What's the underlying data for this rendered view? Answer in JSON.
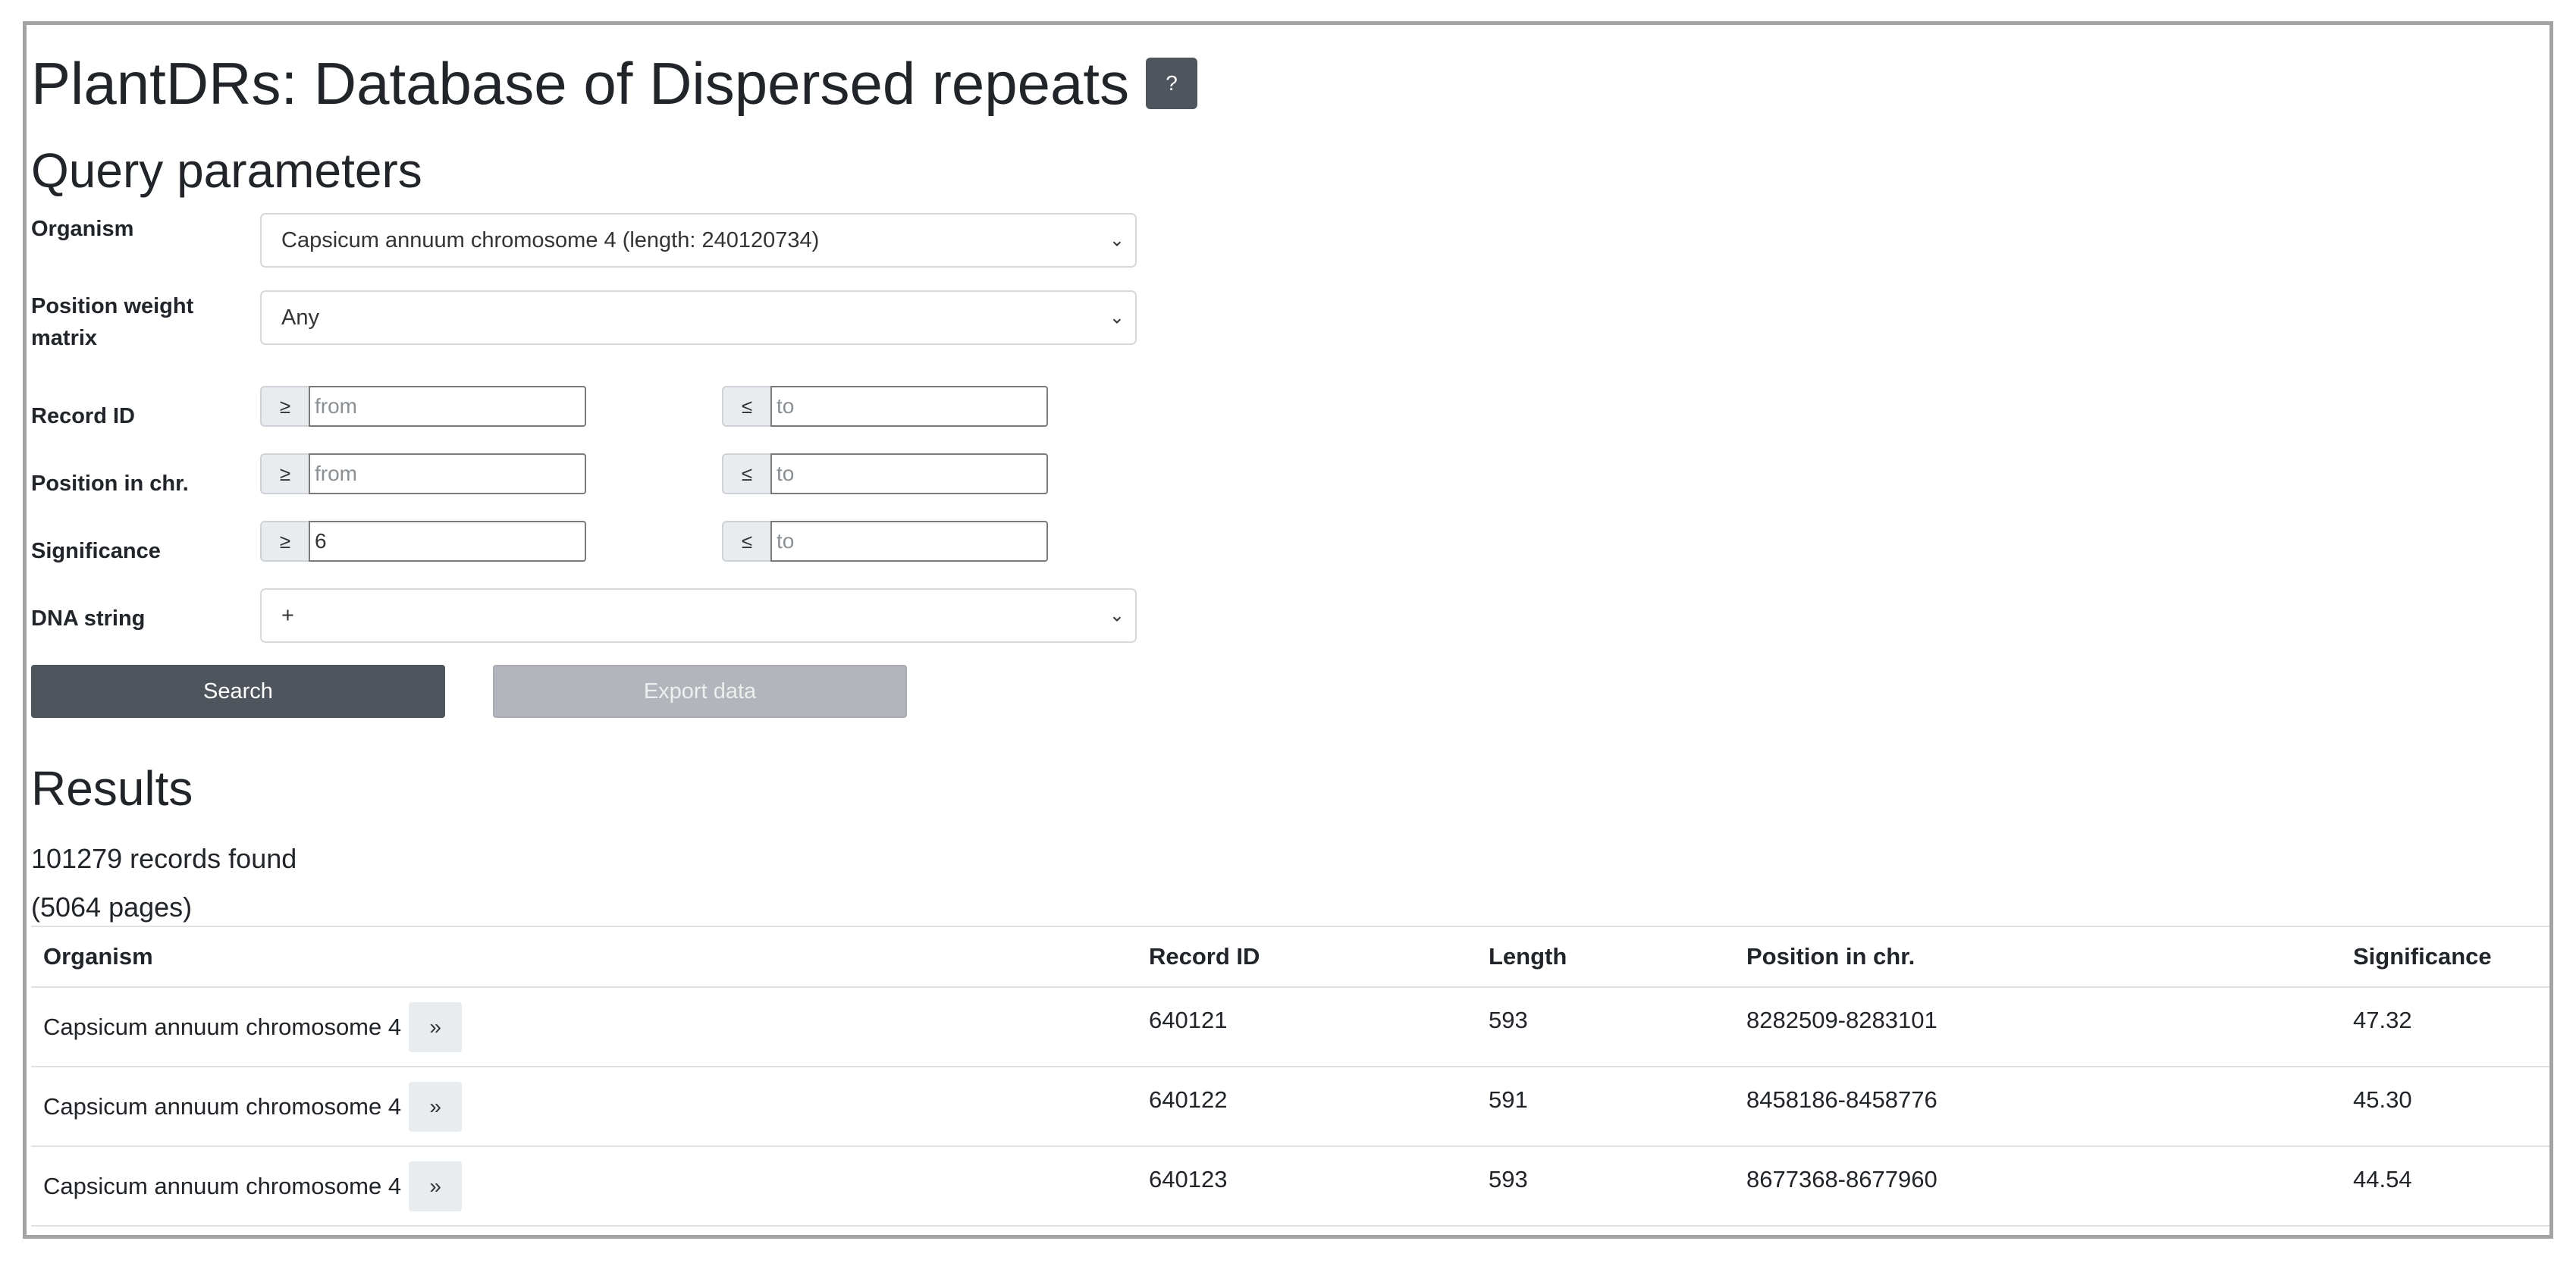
{
  "page": {
    "title": "PlantDRs: Database of Dispersed repeats",
    "help_label": "?"
  },
  "query": {
    "heading": "Query parameters",
    "organism": {
      "label": "Organism",
      "value": "Capsicum annuum chromosome 4 (length: 240120734)"
    },
    "pwm": {
      "label": "Position weight matrix",
      "value": "Any"
    },
    "record_id": {
      "label": "Record ID",
      "ge": "≥",
      "le": "≤",
      "from_placeholder": "from",
      "to_placeholder": "to"
    },
    "position": {
      "label": "Position in chr.",
      "ge": "≥",
      "le": "≤",
      "from_placeholder": "from",
      "to_placeholder": "to"
    },
    "significance": {
      "label": "Significance",
      "ge": "≥",
      "le": "≤",
      "from_value": "6",
      "to_placeholder": "to"
    },
    "dna_string": {
      "label": "DNA string",
      "value": "+"
    },
    "search_label": "Search",
    "export_label": "Export data"
  },
  "results": {
    "heading": "Results",
    "count_text": "101279 records found",
    "pages_text": "(5064 pages)",
    "columns": [
      "Organism",
      "Record ID",
      "Length",
      "Position in chr.",
      "Significance"
    ],
    "expand_label": "»",
    "rows": [
      {
        "organism": "Capsicum annuum chromosome 4",
        "record_id": "640121",
        "length": "593",
        "position": "8282509-8283101",
        "significance": "47.32"
      },
      {
        "organism": "Capsicum annuum chromosome 4",
        "record_id": "640122",
        "length": "591",
        "position": "8458186-8458776",
        "significance": "45.30"
      },
      {
        "organism": "Capsicum annuum chromosome 4",
        "record_id": "640123",
        "length": "593",
        "position": "8677368-8677960",
        "significance": "44.54"
      }
    ]
  }
}
